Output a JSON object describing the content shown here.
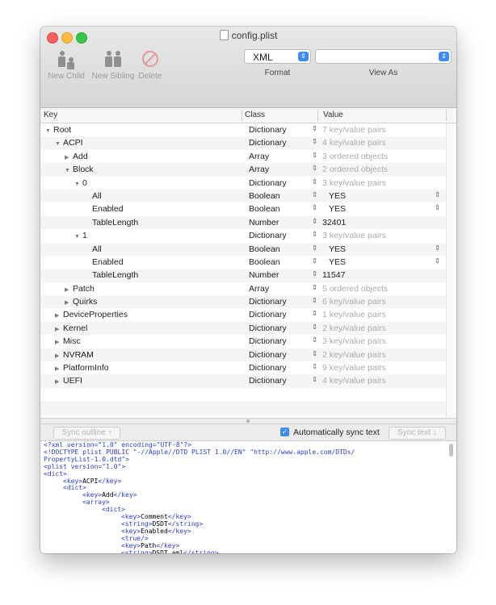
{
  "window": {
    "title": "config.plist"
  },
  "toolbar": {
    "new_child": "New Child",
    "new_sibling": "New Sibling",
    "delete": "Delete",
    "format_value": "XML",
    "format_label": "Format",
    "viewas_value": "",
    "viewas_label": "View As"
  },
  "columns": {
    "key": "Key",
    "class": "Class",
    "value": "Value"
  },
  "rows": [
    {
      "indent": 0,
      "expander": "open",
      "key": "Root",
      "class": "Dictionary",
      "value": "7 key/value pairs",
      "dim": true
    },
    {
      "indent": 1,
      "expander": "open",
      "key": "ACPI",
      "class": "Dictionary",
      "value": "4 key/value pairs",
      "dim": true
    },
    {
      "indent": 2,
      "expander": "closed",
      "key": "Add",
      "class": "Array",
      "value": "3 ordered objects",
      "dim": true
    },
    {
      "indent": 2,
      "expander": "open",
      "key": "Block",
      "class": "Array",
      "value": "2 ordered objects",
      "dim": true
    },
    {
      "indent": 3,
      "expander": "open",
      "key": "0",
      "class": "Dictionary",
      "value": "3 key/value pairs",
      "dim": true
    },
    {
      "indent": 4,
      "expander": "none",
      "key": "All",
      "class": "Boolean",
      "value": "YES",
      "dim": false,
      "popup": true
    },
    {
      "indent": 4,
      "expander": "none",
      "key": "Enabled",
      "class": "Boolean",
      "value": "YES",
      "dim": false,
      "popup": true
    },
    {
      "indent": 4,
      "expander": "none",
      "key": "TableLength",
      "class": "Number",
      "value": "32401",
      "dim": false
    },
    {
      "indent": 3,
      "expander": "open",
      "key": "1",
      "class": "Dictionary",
      "value": "3 key/value pairs",
      "dim": true
    },
    {
      "indent": 4,
      "expander": "none",
      "key": "All",
      "class": "Boolean",
      "value": "YES",
      "dim": false,
      "popup": true
    },
    {
      "indent": 4,
      "expander": "none",
      "key": "Enabled",
      "class": "Boolean",
      "value": "YES",
      "dim": false,
      "popup": true
    },
    {
      "indent": 4,
      "expander": "none",
      "key": "TableLength",
      "class": "Number",
      "value": "11547",
      "dim": false
    },
    {
      "indent": 2,
      "expander": "closed",
      "key": "Patch",
      "class": "Array",
      "value": "5 ordered objects",
      "dim": true
    },
    {
      "indent": 2,
      "expander": "closed",
      "key": "Quirks",
      "class": "Dictionary",
      "value": "6 key/value pairs",
      "dim": true
    },
    {
      "indent": 1,
      "expander": "closed",
      "key": "DeviceProperties",
      "class": "Dictionary",
      "value": "1 key/value pairs",
      "dim": true
    },
    {
      "indent": 1,
      "expander": "closed",
      "key": "Kernel",
      "class": "Dictionary",
      "value": "2 key/value pairs",
      "dim": true
    },
    {
      "indent": 1,
      "expander": "closed",
      "key": "Misc",
      "class": "Dictionary",
      "value": "3 key/value pairs",
      "dim": true
    },
    {
      "indent": 1,
      "expander": "closed",
      "key": "NVRAM",
      "class": "Dictionary",
      "value": "2 key/value pairs",
      "dim": true
    },
    {
      "indent": 1,
      "expander": "closed",
      "key": "PlatformInfo",
      "class": "Dictionary",
      "value": "9 key/value pairs",
      "dim": true
    },
    {
      "indent": 1,
      "expander": "closed",
      "key": "UEFI",
      "class": "Dictionary",
      "value": "4 key/value pairs",
      "dim": true
    }
  ],
  "empty_rows": 3,
  "sync": {
    "sync_outline": "Sync outline ↑",
    "auto_sync_label": "Automatically sync text",
    "auto_sync_checked": true,
    "sync_text": "Sync text ↓"
  },
  "xml_lines": [
    {
      "t": "<?xml version=\"1.0\" encoding=\"UTF-8\"?>"
    },
    {
      "t": "<!DOCTYPE plist PUBLIC \"-//Apple//DTD PLIST 1.0//EN\" \"http://www.apple.com/DTDs/"
    },
    {
      "t": "PropertyList-1.0.dtd\">"
    },
    {
      "t": "<plist version=\"1.0\">"
    },
    {
      "t": "<dict>"
    },
    {
      "i": 1,
      "o": "<key>",
      "v": "ACPI",
      "c": "</key>"
    },
    {
      "i": 1,
      "t": "<dict>"
    },
    {
      "i": 2,
      "o": "<key>",
      "v": "Add",
      "c": "</key>"
    },
    {
      "i": 2,
      "t": "<array>"
    },
    {
      "i": 3,
      "t": "<dict>"
    },
    {
      "i": 4,
      "o": "<key>",
      "v": "Comment",
      "c": "</key>"
    },
    {
      "i": 4,
      "o": "<string>",
      "v": "DSDT",
      "c": "</string>"
    },
    {
      "i": 4,
      "o": "<key>",
      "v": "Enabled",
      "c": "</key>"
    },
    {
      "i": 4,
      "t": "<true/>"
    },
    {
      "i": 4,
      "o": "<key>",
      "v": "Path",
      "c": "</key>"
    },
    {
      "i": 4,
      "o": "<string>",
      "v": "DSDT.aml",
      "c": "</string>"
    }
  ],
  "colors": {
    "accent": "#3d8cf5",
    "xml_tag": "#2a3bd6"
  }
}
